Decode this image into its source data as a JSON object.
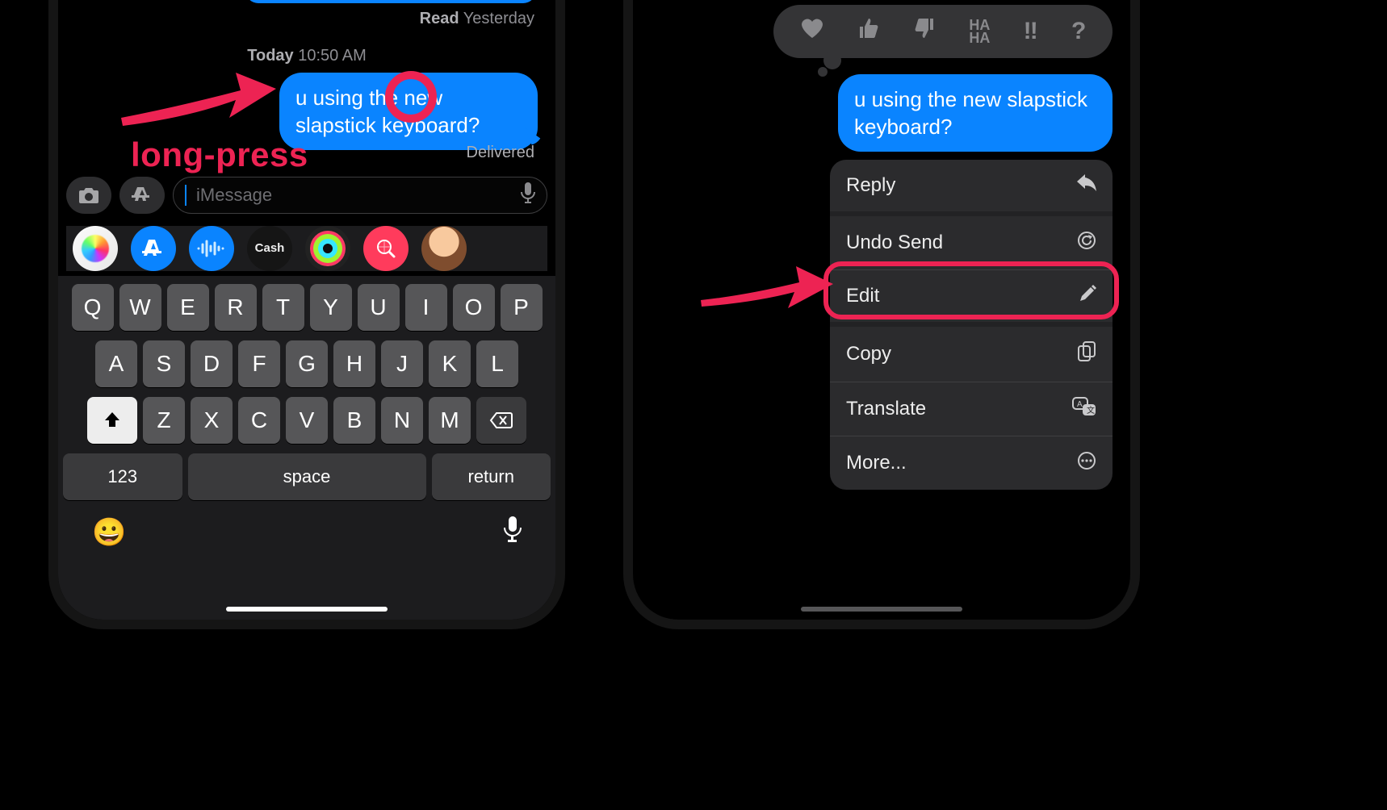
{
  "left": {
    "read_label": "Read",
    "read_when": "Yesterday",
    "timestamp_day": "Today",
    "timestamp_time": "10:50 AM",
    "message": "u using the new slapstick keyboard?",
    "delivered": "Delivered",
    "compose_placeholder": "iMessage",
    "app_strip": {
      "cash_label": "Cash"
    },
    "keyboard": {
      "row1": [
        "Q",
        "W",
        "E",
        "R",
        "T",
        "Y",
        "U",
        "I",
        "O",
        "P"
      ],
      "row2": [
        "A",
        "S",
        "D",
        "F",
        "G",
        "H",
        "J",
        "K",
        "L"
      ],
      "row3": [
        "Z",
        "X",
        "C",
        "V",
        "B",
        "N",
        "M"
      ],
      "numbers": "123",
      "space": "space",
      "return": "return"
    },
    "annotation_label": "long-press"
  },
  "right": {
    "message": "u using the new slapstick keyboard?",
    "tapbacks": [
      "❤",
      "👍",
      "👎",
      "HA HA",
      "‼",
      "?"
    ],
    "menu": {
      "reply": "Reply",
      "undo": "Undo Send",
      "edit": "Edit",
      "copy": "Copy",
      "translate": "Translate",
      "more": "More..."
    }
  }
}
